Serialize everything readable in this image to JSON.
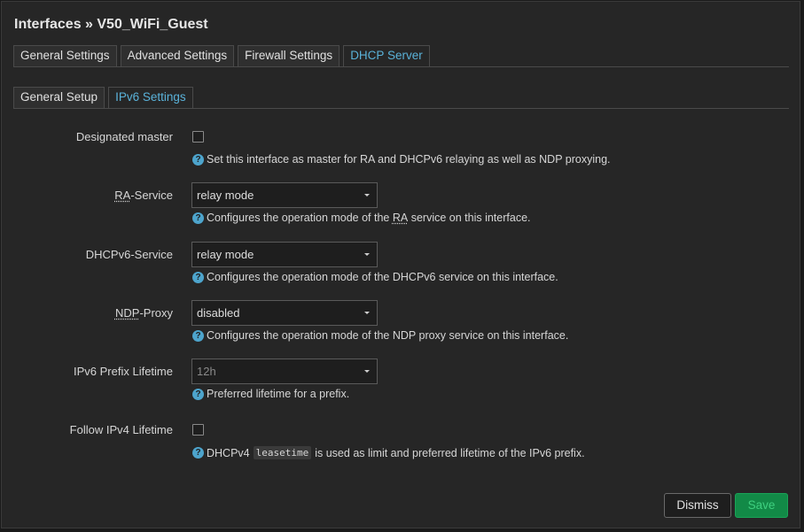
{
  "dialog": {
    "title": "Interfaces » V50_WiFi_Guest"
  },
  "main_tabs": [
    {
      "label": "General Settings",
      "active": false
    },
    {
      "label": "Advanced Settings",
      "active": false
    },
    {
      "label": "Firewall Settings",
      "active": false
    },
    {
      "label": "DHCP Server",
      "active": true
    }
  ],
  "sub_tabs": [
    {
      "label": "General Setup",
      "active": false
    },
    {
      "label": "IPv6 Settings",
      "active": true
    }
  ],
  "fields": {
    "designated_master": {
      "label": "Designated master",
      "checked": false,
      "help": "Set this interface as master for RA and DHCPv6 relaying as well as NDP proxying."
    },
    "ra_service": {
      "label_abbr": "RA",
      "label_rest": "-Service",
      "value": "relay mode",
      "help_pre": "Configures the operation mode of the ",
      "help_abbr": "RA",
      "help_post": " service on this interface."
    },
    "dhcpv6_service": {
      "label": "DHCPv6-Service",
      "value": "relay mode",
      "help": "Configures the operation mode of the DHCPv6 service on this interface."
    },
    "ndp_proxy": {
      "label_abbr": "NDP",
      "label_rest": "-Proxy",
      "value": "disabled",
      "help": "Configures the operation mode of the NDP proxy service on this interface."
    },
    "ipv6_prefix_lifetime": {
      "label": "IPv6 Prefix Lifetime",
      "placeholder": "12h",
      "help": "Preferred lifetime for a prefix."
    },
    "follow_ipv4_lifetime": {
      "label": "Follow IPv4 Lifetime",
      "checked": false,
      "help_pre": "DHCPv4",
      "help_code": "leasetime",
      "help_post": "is used as limit and preferred lifetime of the IPv6 prefix."
    }
  },
  "buttons": {
    "dismiss": "Dismiss",
    "save": "Save"
  },
  "icons": {
    "help": "question-circle-icon",
    "caret": "caret-down-icon"
  },
  "colors": {
    "accent": "#5ab2d9",
    "save_bg": "#128a47",
    "save_text": "#3fd07f"
  }
}
